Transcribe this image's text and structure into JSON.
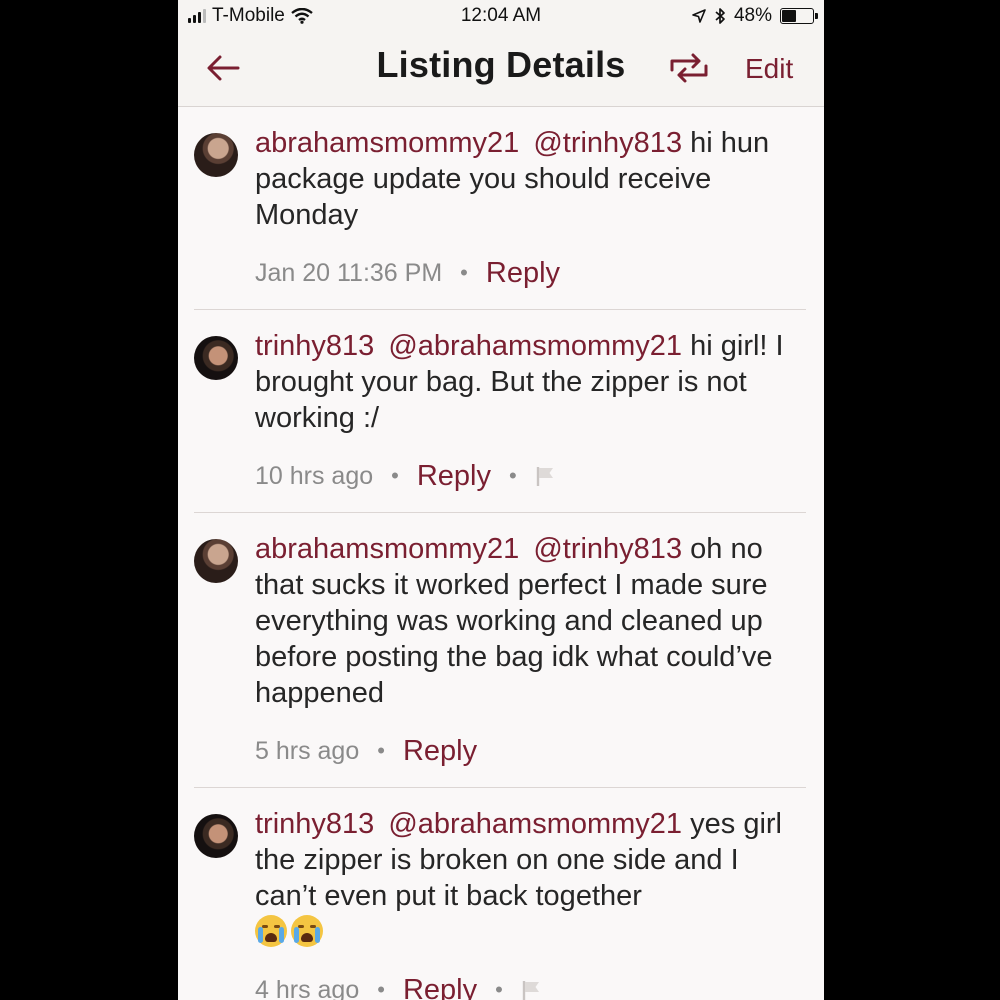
{
  "status_bar": {
    "carrier": "T-Mobile",
    "time": "12:04 AM",
    "battery": "48%",
    "battery_level": 0.48,
    "icons": [
      "signal-icon",
      "wifi-icon",
      "location-icon",
      "bluetooth-icon",
      "battery-icon"
    ]
  },
  "header": {
    "title": "Listing Details",
    "edit_label": "Edit",
    "back_icon": "arrow-left-icon",
    "share_icon": "repost-icon"
  },
  "colors": {
    "accent": "#7a1f31",
    "text": "#262626",
    "muted": "#8a8a8a",
    "background": "#faf8f8"
  },
  "comments": [
    {
      "username": "abrahamsmommy21",
      "mention": "@trinhy813",
      "text": " hi hun package update you should receive Monday",
      "time": "Jan 20 11:36 PM",
      "reply_label": "Reply",
      "has_flag": false
    },
    {
      "username": "trinhy813",
      "mention": "@abrahamsmommy21",
      "text": " hi girl! I brought your bag. But the zipper is not working :/",
      "time": "10 hrs ago",
      "reply_label": "Reply",
      "has_flag": true
    },
    {
      "username": "abrahamsmommy21",
      "mention": "@trinhy813",
      "text": " oh no that sucks it worked perfect I made sure everything was working and cleaned up before posting the bag idk what could’ve happened",
      "time": "5 hrs ago",
      "reply_label": "Reply",
      "has_flag": false
    },
    {
      "username": "trinhy813",
      "mention": "@abrahamsmommy21",
      "text": " yes girl the zipper is broken on one side and I can’t even put it back together",
      "emojis": [
        "crying-face-emoji",
        "crying-face-emoji"
      ],
      "time": "4 hrs ago",
      "reply_label": "Reply",
      "has_flag": true
    }
  ]
}
